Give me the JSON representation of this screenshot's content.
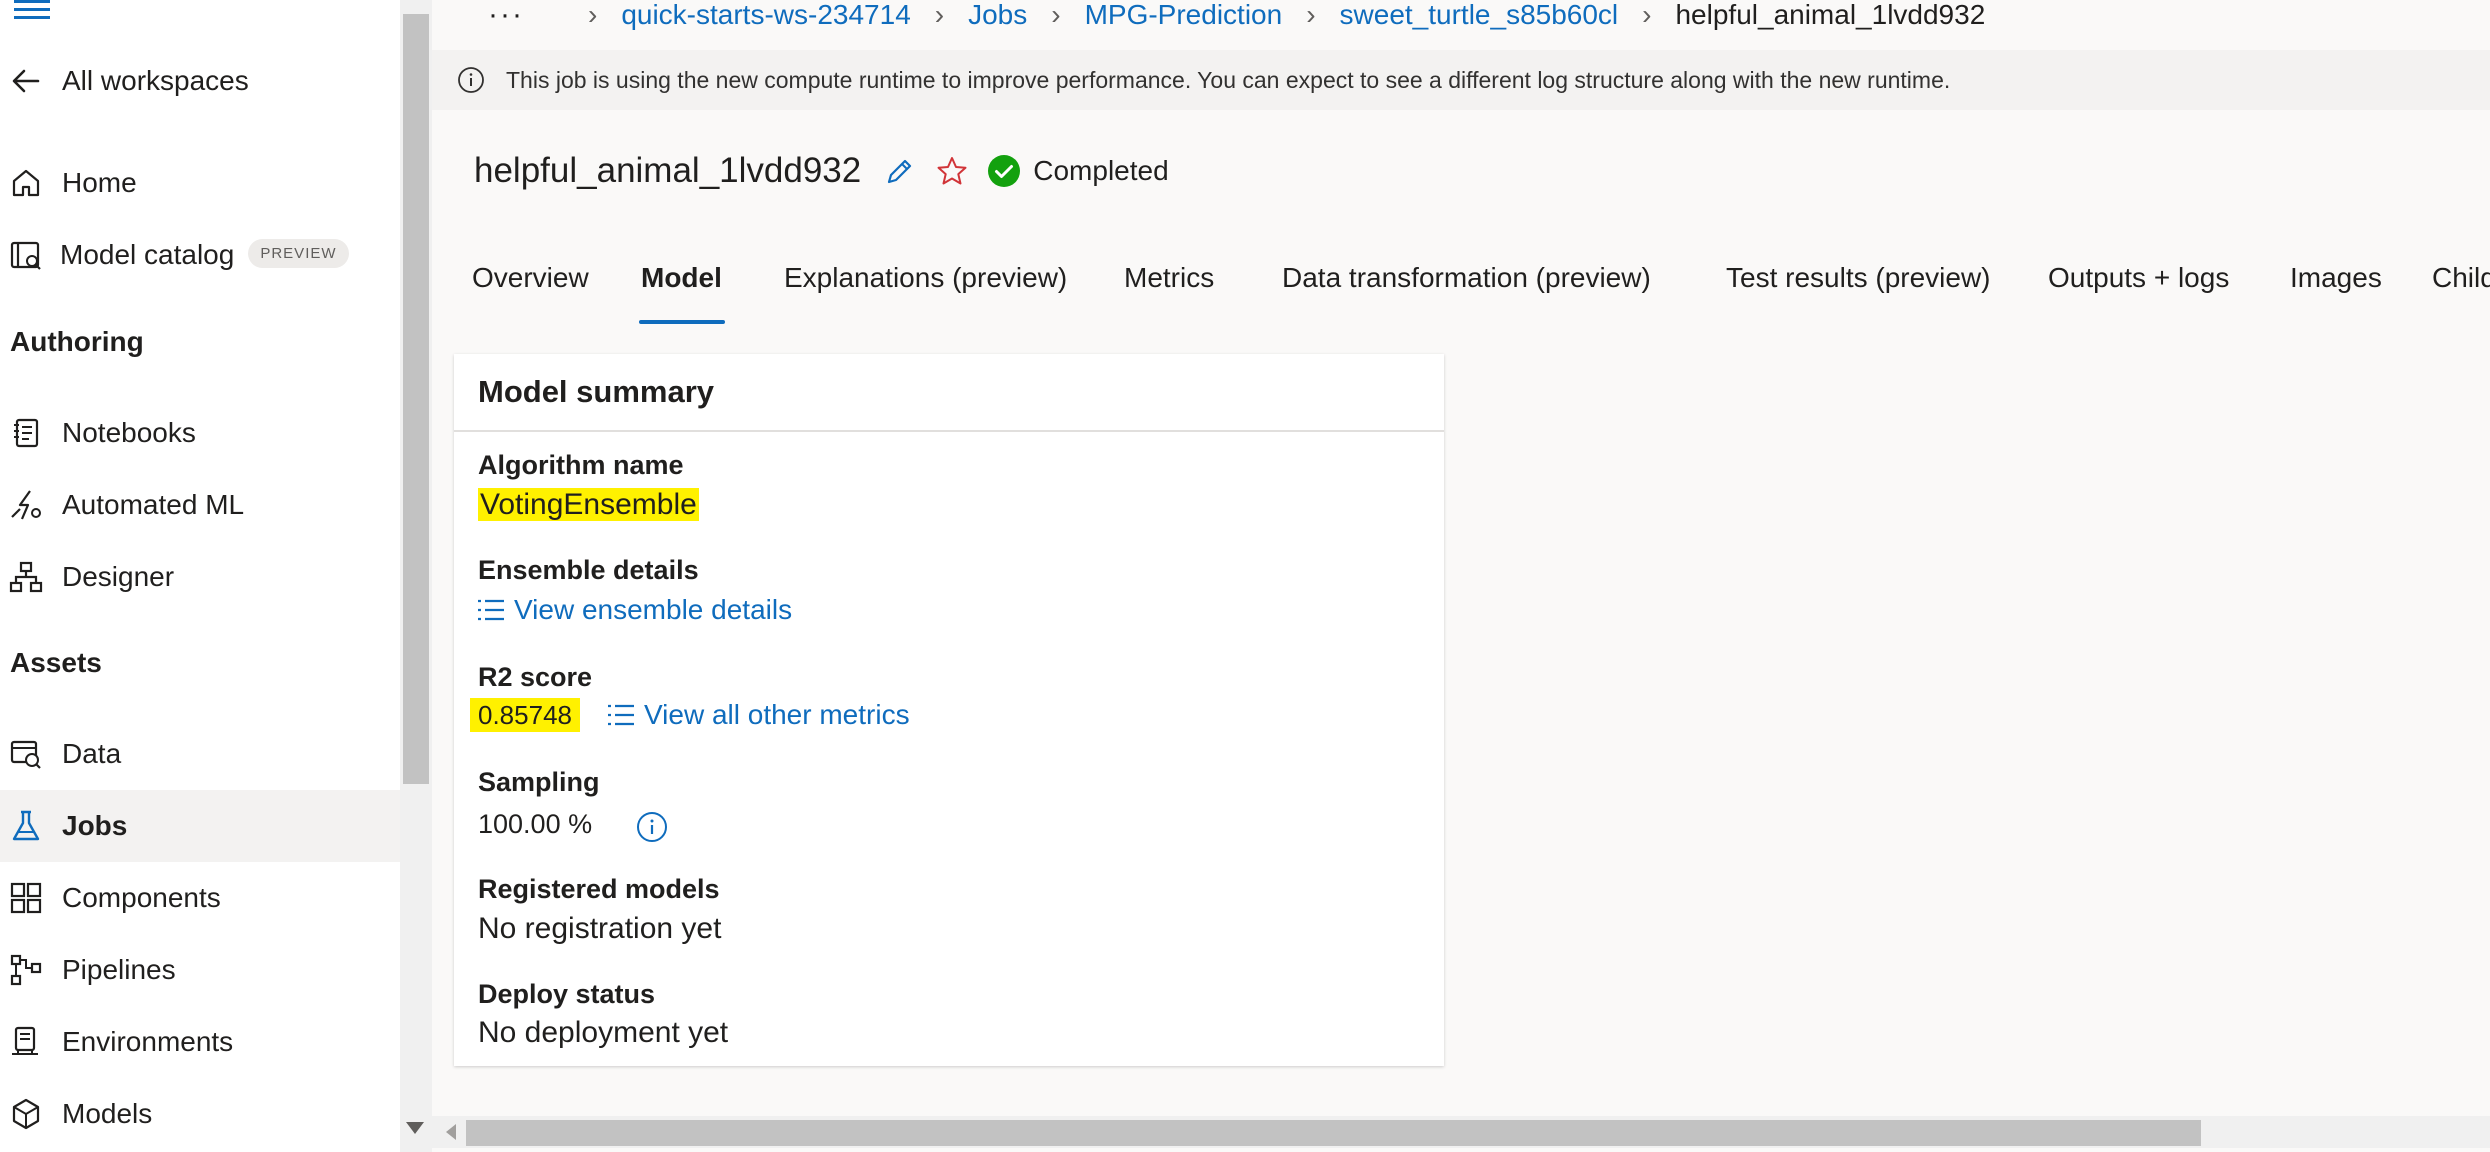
{
  "sidebar": {
    "back_label": "All workspaces",
    "items_top": [
      {
        "label": "Home",
        "icon": "home-icon"
      },
      {
        "label": "Model catalog",
        "icon": "model-catalog-icon",
        "badge": "PREVIEW"
      }
    ],
    "authoring_heading": "Authoring",
    "authoring_items": [
      {
        "label": "Notebooks",
        "icon": "notebook-icon"
      },
      {
        "label": "Automated ML",
        "icon": "automated-ml-icon"
      },
      {
        "label": "Designer",
        "icon": "designer-icon"
      }
    ],
    "assets_heading": "Assets",
    "assets_items": [
      {
        "label": "Data",
        "icon": "data-icon"
      },
      {
        "label": "Jobs",
        "icon": "jobs-flask-icon",
        "selected": true
      },
      {
        "label": "Components",
        "icon": "components-icon"
      },
      {
        "label": "Pipelines",
        "icon": "pipelines-icon"
      },
      {
        "label": "Environments",
        "icon": "environments-icon"
      },
      {
        "label": "Models",
        "icon": "models-cube-icon"
      }
    ]
  },
  "breadcrumb": {
    "more": "···",
    "items": [
      "quick-starts-ws-234714",
      "Jobs",
      "MPG-Prediction",
      "sweet_turtle_s85b60cl"
    ],
    "current": "helpful_animal_1lvdd932"
  },
  "info_bar": {
    "text": "This job is using the new compute runtime to improve performance. You can expect to see a different log structure along with the new runtime."
  },
  "job": {
    "title": "helpful_animal_1lvdd932",
    "status": "Completed"
  },
  "tabs": [
    {
      "label": "Overview"
    },
    {
      "label": "Model",
      "active": true
    },
    {
      "label": "Explanations (preview)"
    },
    {
      "label": "Metrics"
    },
    {
      "label": "Data transformation (preview)"
    },
    {
      "label": "Test results (preview)"
    },
    {
      "label": "Outputs + logs"
    },
    {
      "label": "Images"
    },
    {
      "label": "Child"
    }
  ],
  "model_summary": {
    "title": "Model summary",
    "algorithm_label": "Algorithm name",
    "algorithm_value": "VotingEnsemble",
    "ensemble_label": "Ensemble details",
    "ensemble_link": "View ensemble details",
    "r2_label": "R2 score",
    "r2_value": "0.85748",
    "metrics_link": "View all other metrics",
    "sampling_label": "Sampling",
    "sampling_value": "100.00 %",
    "registered_label": "Registered models",
    "registered_value": "No registration yet",
    "deploy_label": "Deploy status",
    "deploy_value": "No deployment yet"
  },
  "colors": {
    "accent": "#0f6cbd",
    "highlight": "#fff100",
    "success": "#13a10e",
    "star": "#d13438"
  }
}
